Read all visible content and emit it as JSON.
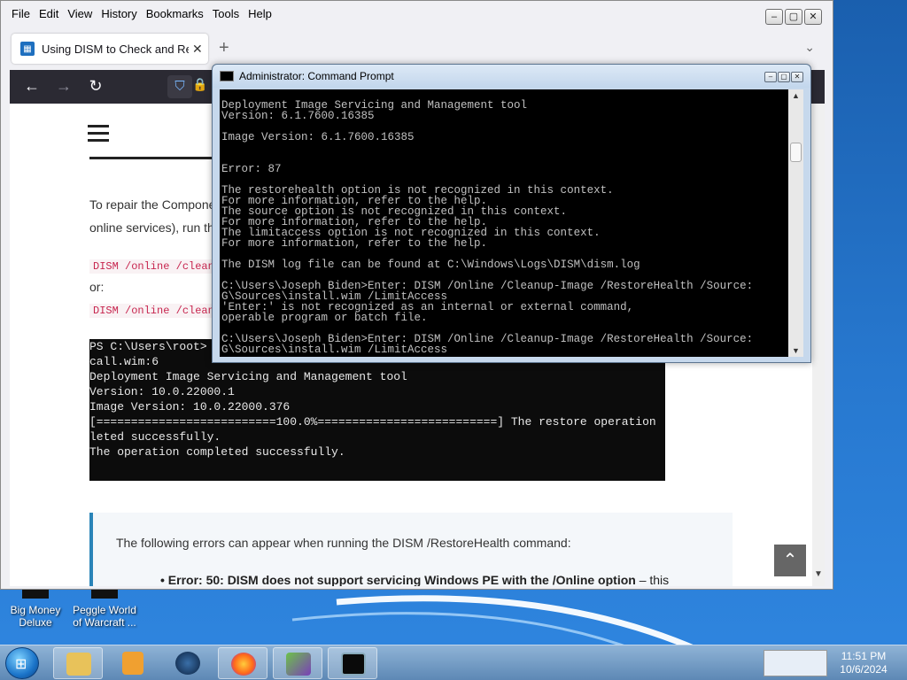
{
  "browser": {
    "menu": [
      "File",
      "Edit",
      "View",
      "History",
      "Bookmarks",
      "Tools",
      "Help"
    ],
    "tab_title": "Using DISM to Check and Repair",
    "tab_close": "✕",
    "new_tab": "+"
  },
  "page": {
    "para1": "To repair the Compone",
    "para2": "online services), run th",
    "code1": "DISM /online /clean",
    "or": "or:",
    "code2": "DISM /online /clean",
    "screenshot_lines": [
      "PS C:\\Users\\root>",
      "call.wim:6",
      "Deployment Image Servicing and Management tool",
      "Version: 10.0.22000.1",
      "",
      "Image Version: 10.0.22000.376",
      "",
      "[==========================100.0%==========================] The restore operation",
      "leted successfully.",
      "The operation completed successfully."
    ],
    "info_text": "The following errors can appear when running the DISM /RestoreHealth command:",
    "info_bullet": "• Error: 50: DISM does not support servicing Windows PE with the /Online option",
    "info_bullet_tail": " – this"
  },
  "cmd": {
    "title": "Administrator: Command Prompt",
    "lines": [
      "Deployment Image Servicing and Management tool",
      "Version: 6.1.7600.16385",
      "",
      "Image Version: 6.1.7600.16385",
      "",
      "",
      "Error: 87",
      "",
      "The restorehealth option is not recognized in this context.",
      "For more information, refer to the help.",
      "The source option is not recognized in this context.",
      "For more information, refer to the help.",
      "The limitaccess option is not recognized in this context.",
      "For more information, refer to the help.",
      "",
      "The DISM log file can be found at C:\\Windows\\Logs\\DISM\\dism.log",
      "",
      "C:\\Users\\Joseph Biden>Enter: DISM /Online /Cleanup-Image /RestoreHealth /Source:",
      "G\\Sources\\install.wim /LimitAccess",
      "'Enter:' is not recognized as an internal or external command,",
      "operable program or batch file.",
      "",
      "C:\\Users\\Joseph Biden>Enter: DISM /Online /Cleanup-Image /RestoreHealth /Source:",
      "G\\Sources\\install.wim /LimitAccess"
    ]
  },
  "desktop": {
    "icon1": "Big Money Deluxe",
    "icon2": "Peggle World of Warcraft ..."
  },
  "taskbar": {
    "time": "11:51 PM",
    "date": "10/6/2024"
  },
  "colors": {
    "console_bg": "#000000",
    "console_text": "#c0c0c0",
    "browser_toolbar": "#2b2a33"
  }
}
